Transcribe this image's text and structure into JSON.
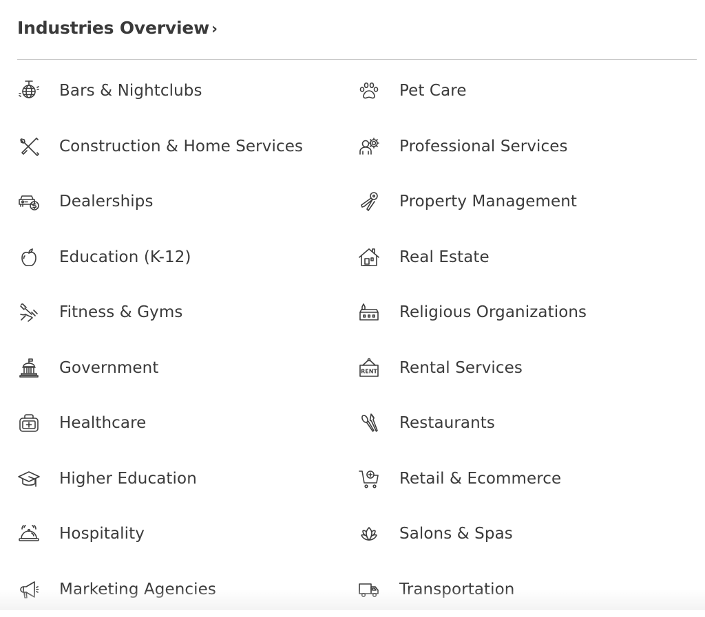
{
  "header": {
    "title": "Industries Overview",
    "chevron": "›"
  },
  "industries": [
    {
      "label": "Bars & Nightclubs",
      "icon": "disco-ball-icon"
    },
    {
      "label": "Pet Care",
      "icon": "paw-print-icon"
    },
    {
      "label": "Construction & Home Services",
      "icon": "wrench-screwdriver-icon"
    },
    {
      "label": "Professional Services",
      "icon": "person-gear-icon"
    },
    {
      "label": "Dealerships",
      "icon": "car-dollar-icon"
    },
    {
      "label": "Property Management",
      "icon": "keys-icon"
    },
    {
      "label": "Education (K-12)",
      "icon": "apple-icon"
    },
    {
      "label": "Real Estate",
      "icon": "house-icon"
    },
    {
      "label": "Fitness & Gyms",
      "icon": "dumbbell-hand-icon"
    },
    {
      "label": "Religious Organizations",
      "icon": "church-icon"
    },
    {
      "label": "Government",
      "icon": "capitol-building-icon"
    },
    {
      "label": "Rental Services",
      "icon": "rent-sign-icon",
      "sign_text": "RENT"
    },
    {
      "label": "Healthcare",
      "icon": "medical-kit-icon"
    },
    {
      "label": "Restaurants",
      "icon": "spoon-fork-icon"
    },
    {
      "label": "Higher Education",
      "icon": "graduation-cap-icon"
    },
    {
      "label": "Retail & Ecommerce",
      "icon": "shopping-cart-plus-icon"
    },
    {
      "label": "Hospitality",
      "icon": "service-bell-icon"
    },
    {
      "label": "Salons & Spas",
      "icon": "lotus-icon"
    },
    {
      "label": "Marketing Agencies",
      "icon": "megaphone-icon"
    },
    {
      "label": "Transportation",
      "icon": "delivery-truck-icon"
    }
  ]
}
